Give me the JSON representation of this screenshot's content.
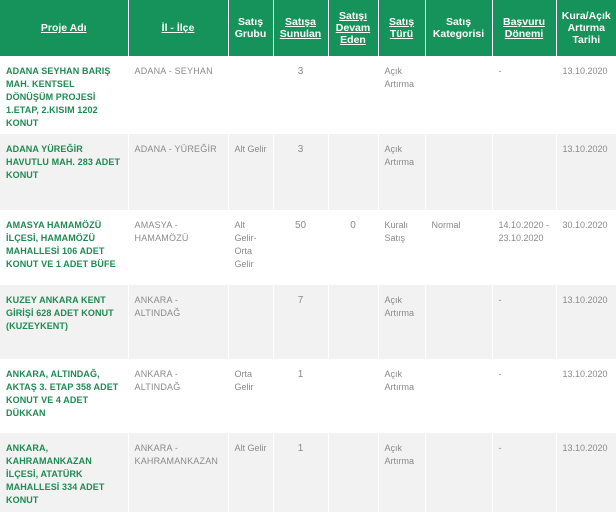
{
  "headers": {
    "proje_adi": "Proje Adı",
    "il_ilce": "İl - İlçe",
    "satis_grubu": "Satış Grubu",
    "satisa_sunulan": "Satışa Sunulan",
    "satisi_devam_eden": "Satışı Devam Eden",
    "satis_turu": "Satış Türü",
    "satis_kategorisi": "Satış Kategorisi",
    "basvuru_donemi": "Başvuru Dönemi",
    "kura_tarihi": "Kura/Açık Artırma Tarihi"
  },
  "rows": [
    {
      "name": "ADANA SEYHAN BARIŞ MAH. KENTSEL DÖNÜŞÜM PROJESİ 1.ETAP, 2.KISIM 1202 KONUT",
      "province": "ADANA - SEYHAN",
      "group": "",
      "offered": "3",
      "ongoing": "",
      "type": "Açık Artırma",
      "category": "",
      "period": "-",
      "date": "13.10.2020"
    },
    {
      "name": "ADANA YÜREĞİR HAVUTLU MAH. 283 ADET KONUT",
      "province": "ADANA - YÜREĞİR",
      "group": "Alt Gelir",
      "offered": "3",
      "ongoing": "",
      "type": "Açık Artırma",
      "category": "",
      "period": "",
      "date": "13.10.2020"
    },
    {
      "name": "AMASYA HAMAMÖZÜ İLÇESİ, HAMAMÖZÜ MAHALLESİ 106 ADET KONUT VE 1 ADET BÜFE",
      "province": "AMASYA - HAMAMÖZÜ",
      "group": "Alt Gelir-Orta Gelir",
      "offered": "50",
      "ongoing": "0",
      "type": "Kuralı Satış",
      "category": "Normal",
      "period": "14.10.2020 - 23.10.2020",
      "date": "30.10.2020"
    },
    {
      "name": "KUZEY ANKARA KENT GİRİŞİ 628 ADET KONUT (KUZEYKENT)",
      "province": "ANKARA - ALTINDAĞ",
      "group": "",
      "offered": "7",
      "ongoing": "",
      "type": "Açık Artırma",
      "category": "",
      "period": "-",
      "date": "13.10.2020"
    },
    {
      "name": "ANKARA, ALTINDAĞ, AKTAŞ 3. ETAP 358 ADET KONUT VE 4 ADET DÜKKAN",
      "province": "ANKARA - ALTINDAĞ",
      "group": "Orta Gelir",
      "offered": "1",
      "ongoing": "",
      "type": "Açık Artırma",
      "category": "",
      "period": "-",
      "date": "13.10.2020"
    },
    {
      "name": "ANKARA, KAHRAMANKAZAN İLÇESİ, ATATÜRK MAHALLESİ 334 ADET KONUT",
      "province": "ANKARA - KAHRAMANKAZAN",
      "group": "Alt Gelir",
      "offered": "1",
      "ongoing": "",
      "type": "Açık Artırma",
      "category": "",
      "period": "-",
      "date": "13.10.2020"
    }
  ]
}
